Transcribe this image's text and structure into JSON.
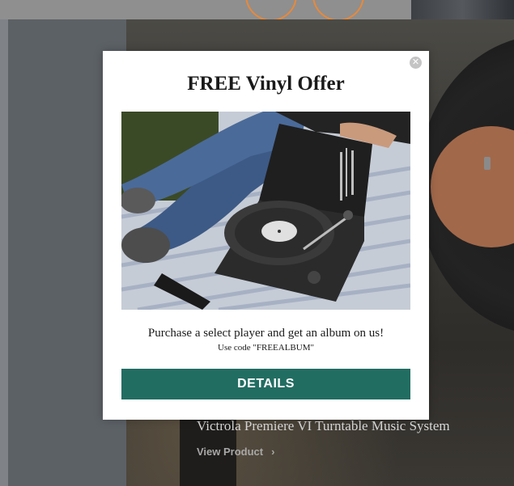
{
  "popup": {
    "title": "FREE Vinyl Offer",
    "close_symbol": "✕",
    "offer_text": "Purchase a select player and get an album on us!",
    "code_text": "Use code \"FREEALBUM\"",
    "details_label": "DETAILS",
    "button_color": "#226d62"
  },
  "background": {
    "product_title": "Victrola Premiere VI Turntable Music System",
    "view_product_label": "View Product",
    "chevron_symbol": "›",
    "accent_color": "#e8893a"
  }
}
